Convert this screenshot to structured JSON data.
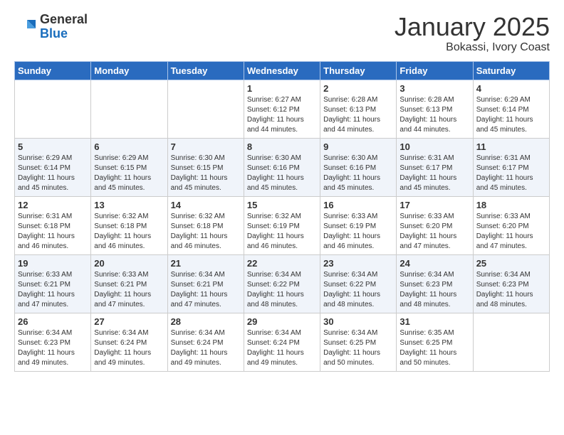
{
  "header": {
    "logo_general": "General",
    "logo_blue": "Blue",
    "month_title": "January 2025",
    "location": "Bokassi, Ivory Coast"
  },
  "days_of_week": [
    "Sunday",
    "Monday",
    "Tuesday",
    "Wednesday",
    "Thursday",
    "Friday",
    "Saturday"
  ],
  "weeks": [
    [
      {
        "day": "",
        "info": ""
      },
      {
        "day": "",
        "info": ""
      },
      {
        "day": "",
        "info": ""
      },
      {
        "day": "1",
        "info": "Sunrise: 6:27 AM\nSunset: 6:12 PM\nDaylight: 11 hours and 44 minutes."
      },
      {
        "day": "2",
        "info": "Sunrise: 6:28 AM\nSunset: 6:13 PM\nDaylight: 11 hours and 44 minutes."
      },
      {
        "day": "3",
        "info": "Sunrise: 6:28 AM\nSunset: 6:13 PM\nDaylight: 11 hours and 44 minutes."
      },
      {
        "day": "4",
        "info": "Sunrise: 6:29 AM\nSunset: 6:14 PM\nDaylight: 11 hours and 45 minutes."
      }
    ],
    [
      {
        "day": "5",
        "info": "Sunrise: 6:29 AM\nSunset: 6:14 PM\nDaylight: 11 hours and 45 minutes."
      },
      {
        "day": "6",
        "info": "Sunrise: 6:29 AM\nSunset: 6:15 PM\nDaylight: 11 hours and 45 minutes."
      },
      {
        "day": "7",
        "info": "Sunrise: 6:30 AM\nSunset: 6:15 PM\nDaylight: 11 hours and 45 minutes."
      },
      {
        "day": "8",
        "info": "Sunrise: 6:30 AM\nSunset: 6:16 PM\nDaylight: 11 hours and 45 minutes."
      },
      {
        "day": "9",
        "info": "Sunrise: 6:30 AM\nSunset: 6:16 PM\nDaylight: 11 hours and 45 minutes."
      },
      {
        "day": "10",
        "info": "Sunrise: 6:31 AM\nSunset: 6:17 PM\nDaylight: 11 hours and 45 minutes."
      },
      {
        "day": "11",
        "info": "Sunrise: 6:31 AM\nSunset: 6:17 PM\nDaylight: 11 hours and 45 minutes."
      }
    ],
    [
      {
        "day": "12",
        "info": "Sunrise: 6:31 AM\nSunset: 6:18 PM\nDaylight: 11 hours and 46 minutes."
      },
      {
        "day": "13",
        "info": "Sunrise: 6:32 AM\nSunset: 6:18 PM\nDaylight: 11 hours and 46 minutes."
      },
      {
        "day": "14",
        "info": "Sunrise: 6:32 AM\nSunset: 6:18 PM\nDaylight: 11 hours and 46 minutes."
      },
      {
        "day": "15",
        "info": "Sunrise: 6:32 AM\nSunset: 6:19 PM\nDaylight: 11 hours and 46 minutes."
      },
      {
        "day": "16",
        "info": "Sunrise: 6:33 AM\nSunset: 6:19 PM\nDaylight: 11 hours and 46 minutes."
      },
      {
        "day": "17",
        "info": "Sunrise: 6:33 AM\nSunset: 6:20 PM\nDaylight: 11 hours and 47 minutes."
      },
      {
        "day": "18",
        "info": "Sunrise: 6:33 AM\nSunset: 6:20 PM\nDaylight: 11 hours and 47 minutes."
      }
    ],
    [
      {
        "day": "19",
        "info": "Sunrise: 6:33 AM\nSunset: 6:21 PM\nDaylight: 11 hours and 47 minutes."
      },
      {
        "day": "20",
        "info": "Sunrise: 6:33 AM\nSunset: 6:21 PM\nDaylight: 11 hours and 47 minutes."
      },
      {
        "day": "21",
        "info": "Sunrise: 6:34 AM\nSunset: 6:21 PM\nDaylight: 11 hours and 47 minutes."
      },
      {
        "day": "22",
        "info": "Sunrise: 6:34 AM\nSunset: 6:22 PM\nDaylight: 11 hours and 48 minutes."
      },
      {
        "day": "23",
        "info": "Sunrise: 6:34 AM\nSunset: 6:22 PM\nDaylight: 11 hours and 48 minutes."
      },
      {
        "day": "24",
        "info": "Sunrise: 6:34 AM\nSunset: 6:23 PM\nDaylight: 11 hours and 48 minutes."
      },
      {
        "day": "25",
        "info": "Sunrise: 6:34 AM\nSunset: 6:23 PM\nDaylight: 11 hours and 48 minutes."
      }
    ],
    [
      {
        "day": "26",
        "info": "Sunrise: 6:34 AM\nSunset: 6:23 PM\nDaylight: 11 hours and 49 minutes."
      },
      {
        "day": "27",
        "info": "Sunrise: 6:34 AM\nSunset: 6:24 PM\nDaylight: 11 hours and 49 minutes."
      },
      {
        "day": "28",
        "info": "Sunrise: 6:34 AM\nSunset: 6:24 PM\nDaylight: 11 hours and 49 minutes."
      },
      {
        "day": "29",
        "info": "Sunrise: 6:34 AM\nSunset: 6:24 PM\nDaylight: 11 hours and 49 minutes."
      },
      {
        "day": "30",
        "info": "Sunrise: 6:34 AM\nSunset: 6:25 PM\nDaylight: 11 hours and 50 minutes."
      },
      {
        "day": "31",
        "info": "Sunrise: 6:35 AM\nSunset: 6:25 PM\nDaylight: 11 hours and 50 minutes."
      },
      {
        "day": "",
        "info": ""
      }
    ]
  ]
}
